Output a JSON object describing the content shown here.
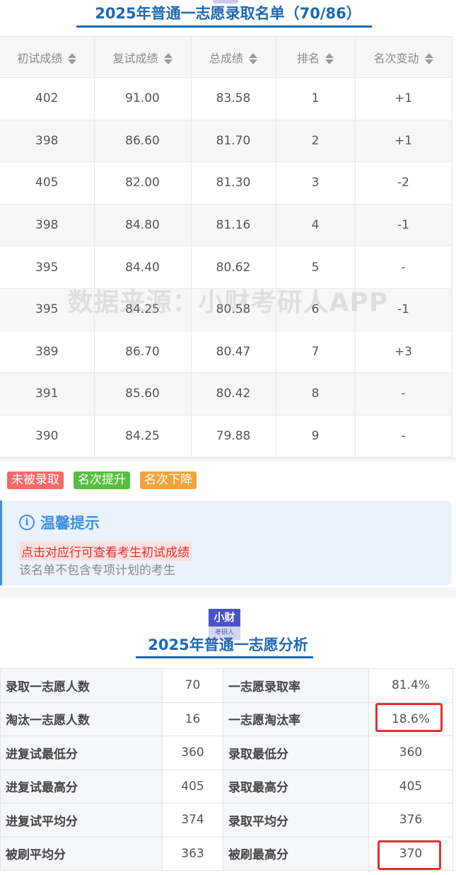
{
  "ranking": {
    "title": "2025年普通一志愿录取名单（70/86）",
    "columns": [
      "初试成绩",
      "复试成绩",
      "总成绩",
      "排名",
      "名次变动"
    ],
    "rows": [
      {
        "initial": "402",
        "retest": "91.00",
        "total": "83.58",
        "rank": "1",
        "change": "+1",
        "trend": "up"
      },
      {
        "initial": "398",
        "retest": "86.60",
        "total": "81.70",
        "rank": "2",
        "change": "+1",
        "trend": "up"
      },
      {
        "initial": "405",
        "retest": "82.00",
        "total": "81.30",
        "rank": "3",
        "change": "-2",
        "trend": "down"
      },
      {
        "initial": "398",
        "retest": "84.80",
        "total": "81.16",
        "rank": "4",
        "change": "-1",
        "trend": "down"
      },
      {
        "initial": "395",
        "retest": "84.40",
        "total": "80.62",
        "rank": "5",
        "change": "-",
        "trend": "none"
      },
      {
        "initial": "395",
        "retest": "84.25",
        "total": "80.58",
        "rank": "6",
        "change": "-1",
        "trend": "down"
      },
      {
        "initial": "389",
        "retest": "86.70",
        "total": "80.47",
        "rank": "7",
        "change": "+3",
        "trend": "up"
      },
      {
        "initial": "391",
        "retest": "85.60",
        "total": "80.42",
        "rank": "8",
        "change": "-",
        "trend": "none"
      },
      {
        "initial": "390",
        "retest": "84.25",
        "total": "79.88",
        "rank": "9",
        "change": "-",
        "trend": "none"
      }
    ]
  },
  "watermark": "数据来源：小财考研人APP",
  "legend": {
    "not_admitted": "未被录取",
    "rank_up": "名次提升",
    "rank_down": "名次下降"
  },
  "tip": {
    "title": "温馨提示",
    "line1": "点击对应行可查看考生初试成绩",
    "line2": "该名单不包含专项计划的考生"
  },
  "logo": {
    "top": "小财",
    "bottom": "考研人"
  },
  "analysis": {
    "title": "2025年普通一志愿分析",
    "rows": [
      {
        "label_a": "录取一志愿人数",
        "value_a": "70",
        "label_b": "一志愿录取率",
        "value_b": "81.4%"
      },
      {
        "label_a": "淘汰一志愿人数",
        "value_a": "16",
        "label_b": "一志愿淘汰率",
        "value_b": "18.6%"
      },
      {
        "label_a": "进复试最低分",
        "value_a": "360",
        "label_b": "录取最低分",
        "value_b": "360"
      },
      {
        "label_a": "进复试最高分",
        "value_a": "405",
        "label_b": "录取最高分",
        "value_b": "405"
      },
      {
        "label_a": "进复试平均分",
        "value_a": "374",
        "label_b": "录取平均分",
        "value_b": "376"
      },
      {
        "label_a": "被刷平均分",
        "value_a": "363",
        "label_b": "被刷最高分",
        "value_b": "370"
      }
    ]
  },
  "colors": {
    "title_blue": "#1e68b5",
    "up_green": "#4caf50",
    "down_orange": "#f0a040",
    "highlight_red": "#e53030"
  }
}
